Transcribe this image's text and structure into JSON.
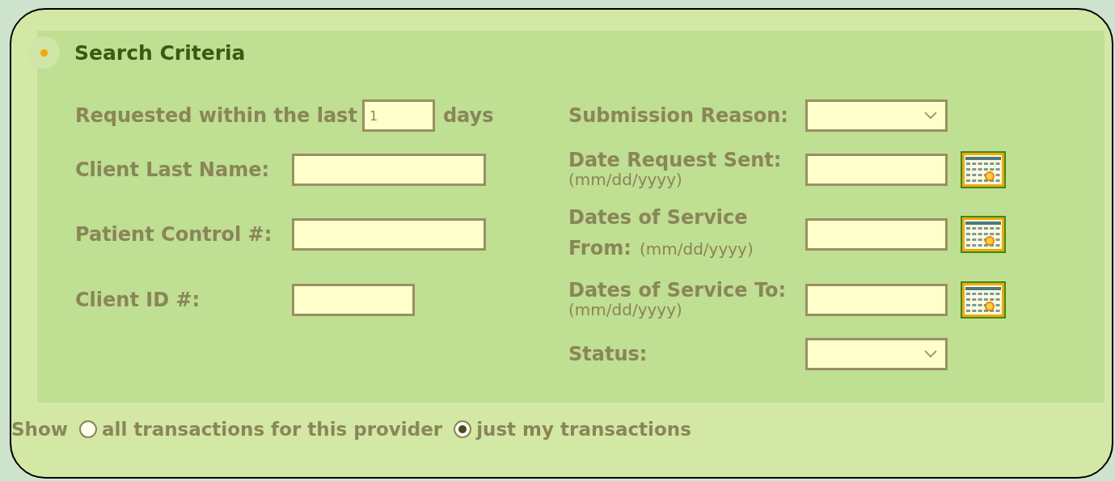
{
  "section": {
    "title": "Search Criteria"
  },
  "left_fields": [
    {
      "kind": "days",
      "label": "Requested within the last",
      "value": "1",
      "suffix": "days"
    },
    {
      "kind": "text",
      "label": "Client Last Name:"
    },
    {
      "kind": "text",
      "label": "Patient Control #:"
    },
    {
      "kind": "shorttext",
      "label": "Client ID #:"
    }
  ],
  "right_fields": [
    {
      "kind": "select",
      "label": "Submission Reason:"
    },
    {
      "kind": "date",
      "label": "Date Request Sent:",
      "hint": "(mm/dd/yyyy)"
    },
    {
      "kind": "datewrap",
      "label": "Dates of Service",
      "label_line2": "From:",
      "hint": "(mm/dd/yyyy)"
    },
    {
      "kind": "date",
      "label": "Dates of Service To:",
      "hint": "(mm/dd/yyyy)"
    },
    {
      "kind": "select",
      "label": "Status:"
    }
  ],
  "show": {
    "label": "Show",
    "options": [
      {
        "label": "all transactions for this provider",
        "selected": false
      },
      {
        "label": "just my transactions",
        "selected": true
      }
    ]
  }
}
